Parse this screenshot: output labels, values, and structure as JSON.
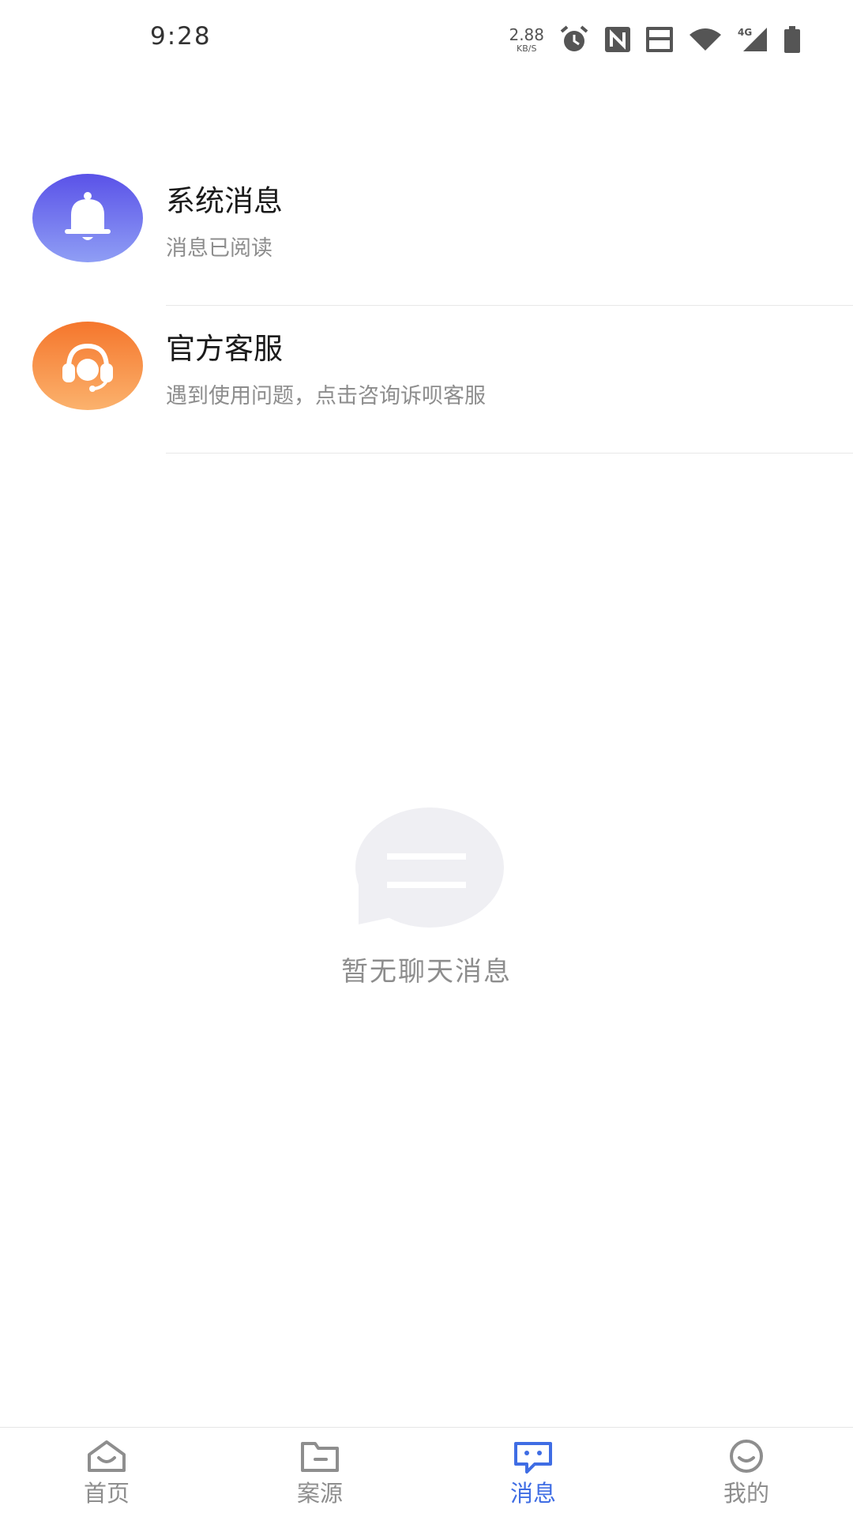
{
  "status_bar": {
    "time": "9:28",
    "net_speed_value": "2.88",
    "net_speed_unit": "KB/S",
    "icons": [
      "alarm-icon",
      "nfc-icon",
      "volte-icon",
      "wifi-icon",
      "signal-4g-icon",
      "battery-icon"
    ],
    "signal_label": "4G"
  },
  "messages": [
    {
      "title": "系统消息",
      "subtitle": "消息已阅读",
      "avatar": "bell-icon",
      "color": "#5a52e8"
    },
    {
      "title": "官方客服",
      "subtitle": "遇到使用问题，点击咨询诉呗客服",
      "avatar": "headset-icon",
      "color": "#f5762c"
    }
  ],
  "empty_state": {
    "text": "暂无聊天消息",
    "icon": "chat-bubble-icon"
  },
  "tabs": [
    {
      "label": "首页",
      "icon": "home-icon"
    },
    {
      "label": "案源",
      "icon": "folder-icon"
    },
    {
      "label": "消息",
      "icon": "message-icon",
      "active": true
    },
    {
      "label": "我的",
      "icon": "profile-icon"
    }
  ],
  "colors": {
    "accent": "#3f6de4",
    "muted": "#8e8e8e"
  }
}
